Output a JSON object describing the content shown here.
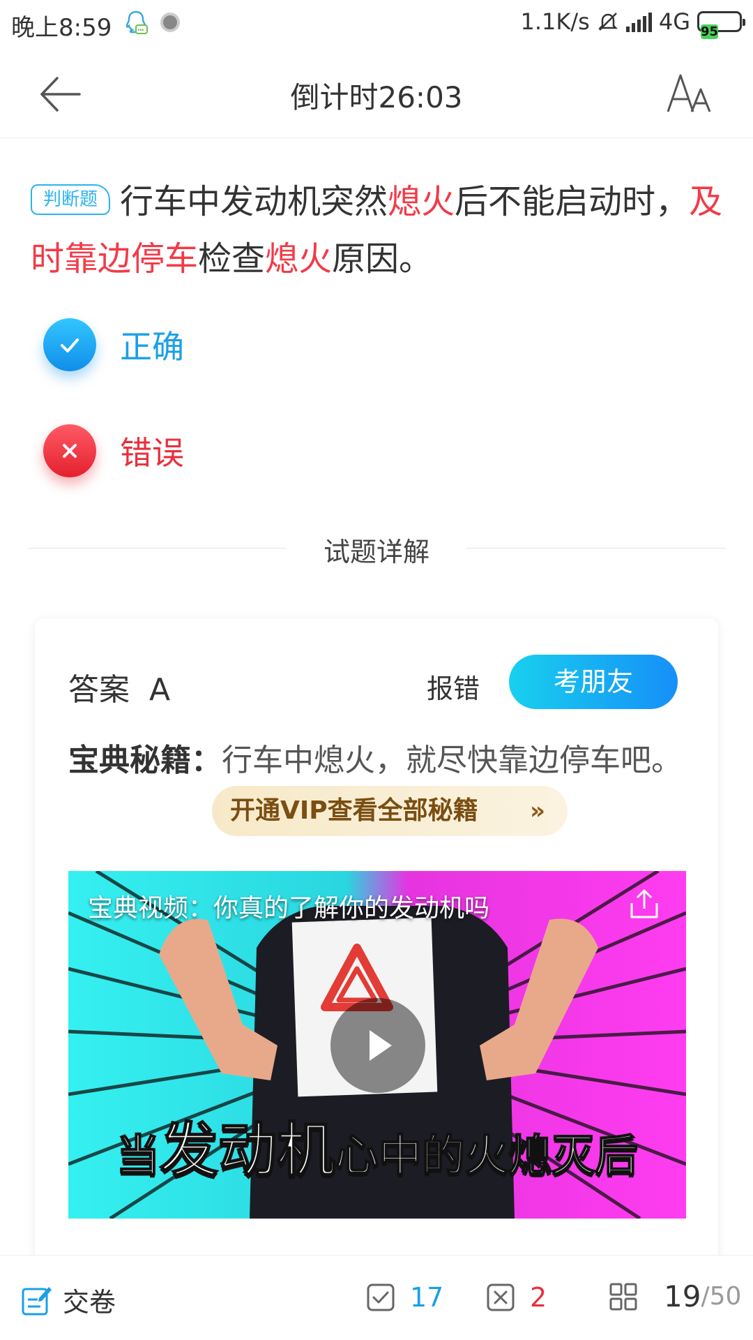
{
  "status_bar": {
    "time": "晚上8:59",
    "network_speed": "1.1K/s",
    "network_type": "4G",
    "battery": "95",
    "icons": [
      "qq-icon",
      "record-icon",
      "mute-icon",
      "signal-icon",
      "battery-icon"
    ]
  },
  "header": {
    "title": "倒计时26:03",
    "back_icon": "back-arrow-icon",
    "font_icon": "font-size-icon"
  },
  "question": {
    "tag": "判断题",
    "parts": {
      "p1": "行车中发动机突然",
      "p2": "熄火",
      "p3": "后不能启动时，",
      "p4": "及时靠边停车",
      "p5": "检查",
      "p6": "熄火",
      "p7": "原因。"
    },
    "highlight_color": "#f23b48"
  },
  "options": {
    "correct_label": "正确",
    "wrong_label": "错误"
  },
  "section": {
    "title": "试题详解"
  },
  "explanation": {
    "answer": "答案  A",
    "report_label": "报错",
    "ask_friend_label": "考朋友",
    "tip_label": "宝典秘籍：",
    "tip_text": "行车中熄火，就尽快靠边停车吧。",
    "vip_label": "开通VIP查看全部秘籍",
    "vip_chevron": "»"
  },
  "video": {
    "title": "宝典视频：你真的了解你的发动机吗",
    "caption_1": "当",
    "caption_2": "发动机",
    "caption_3": "心中的火熄灭后"
  },
  "bottom_bar": {
    "submit_label": "交卷",
    "correct_count": "17",
    "wrong_count": "2",
    "current_index": "19",
    "total": "/50"
  },
  "colors": {
    "accent_blue": "#1a9fe8",
    "accent_red": "#e8303e",
    "vip_text": "#7a4e12"
  }
}
